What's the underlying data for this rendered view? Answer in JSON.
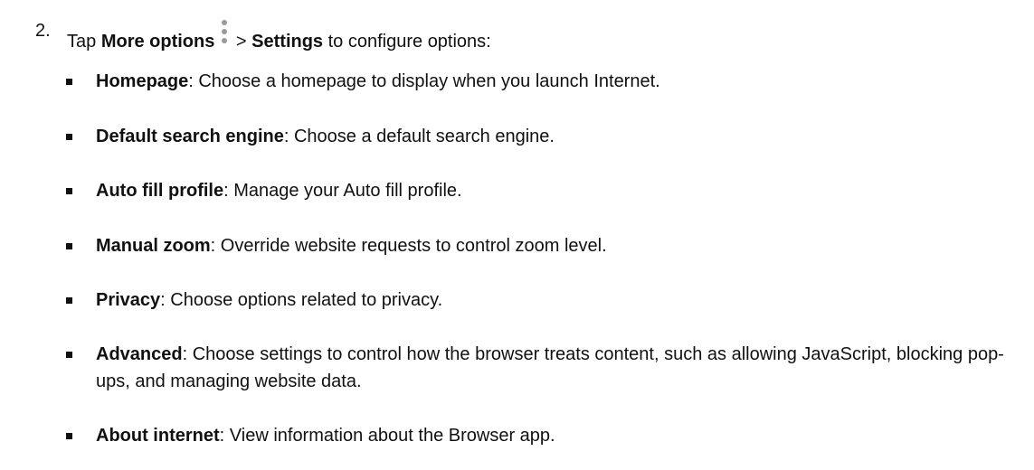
{
  "step": {
    "number": "2.",
    "pre": "Tap ",
    "more_options": "More options",
    "more_options_icon": "vertical-ellipsis-icon",
    "gt": " > ",
    "settings": "Settings",
    "post": " to configure options:"
  },
  "options": [
    {
      "term": "Homepage",
      "desc": ": Choose a homepage to display when you launch Internet."
    },
    {
      "term": "Default search engine",
      "desc": ": Choose a default search engine."
    },
    {
      "term": "Auto fill profile",
      "desc": ": Manage your Auto fill profile."
    },
    {
      "term": "Manual zoom",
      "desc": ": Override website requests to control zoom level."
    },
    {
      "term": "Privacy",
      "desc": ": Choose options related to privacy."
    },
    {
      "term": "Advanced",
      "desc": ": Choose settings to control how the browser treats content, such as allowing JavaScript, blocking pop-ups, and managing website data."
    },
    {
      "term": "About internet",
      "desc": ": View information about the Browser app."
    }
  ]
}
